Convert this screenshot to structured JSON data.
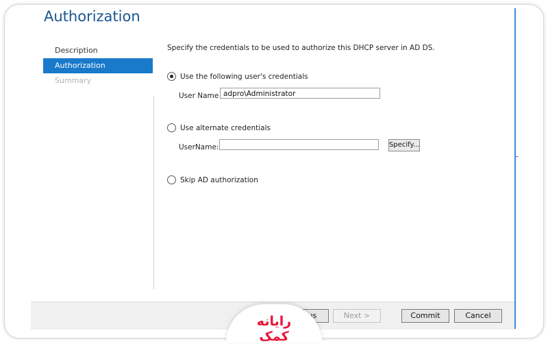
{
  "header": {
    "title": "Authorization"
  },
  "sidebar": {
    "items": [
      {
        "label": "Description"
      },
      {
        "label": "Authorization"
      },
      {
        "label": "Summary"
      }
    ]
  },
  "main": {
    "description": "Specify the credentials to be used to authorize this DHCP server in AD DS.",
    "option_current": {
      "label": "Use the following user's credentials",
      "username_label": "User Name",
      "username_value": "adpro\\Administrator"
    },
    "option_alternate": {
      "label": "Use alternate credentials",
      "username_label": "UserName:",
      "username_value": "",
      "specify_label": "Specify..."
    },
    "option_skip": {
      "label": "Skip AD authorization"
    }
  },
  "footer": {
    "previous_label": "Previous",
    "next_label": "Next >",
    "commit_label": "Commit",
    "cancel_label": "Cancel"
  },
  "watermark": {
    "text": "رایانه کمک"
  },
  "colors": {
    "accent": "#1979ca",
    "title": "#1a5590",
    "watermark": "#e8153a"
  }
}
